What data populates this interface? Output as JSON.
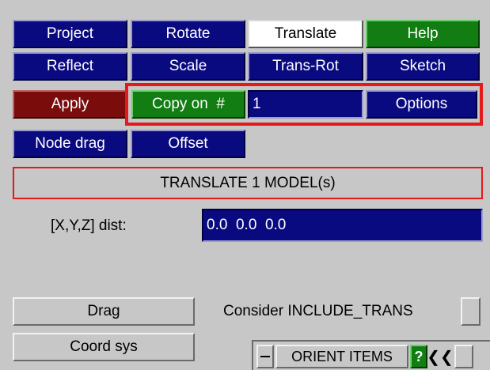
{
  "tabs": [
    {
      "label": "Project"
    },
    {
      "label": "Rotate"
    },
    {
      "label": "Translate"
    },
    {
      "label": "Help"
    },
    {
      "label": "Reflect"
    },
    {
      "label": "Scale"
    },
    {
      "label": "Trans-Rot"
    },
    {
      "label": "Sketch"
    }
  ],
  "apply_label": "Apply",
  "copy_on_label": "Copy on  #",
  "copy_count": "1",
  "options_label": "Options",
  "node_drag_label": "Node drag",
  "offset_label": "Offset",
  "banner": "TRANSLATE 1 MODEL(s)",
  "dist_label": "[X,Y,Z] dist:",
  "dist_value": "0.0  0.0  0.0",
  "drag_label": "Drag",
  "consider_label": "Consider INCLUDE_TRANS",
  "coord_sys_label": "Coord sys",
  "orient_items_label": "ORIENT ITEMS",
  "help_q": "?",
  "collapse_glyph": "❮❮",
  "colors": {
    "navy": "#0a0a80",
    "green": "#127d12",
    "red": "#7a0c0c",
    "highlight": "#e41a1a",
    "panel": "#c7c7c7"
  }
}
